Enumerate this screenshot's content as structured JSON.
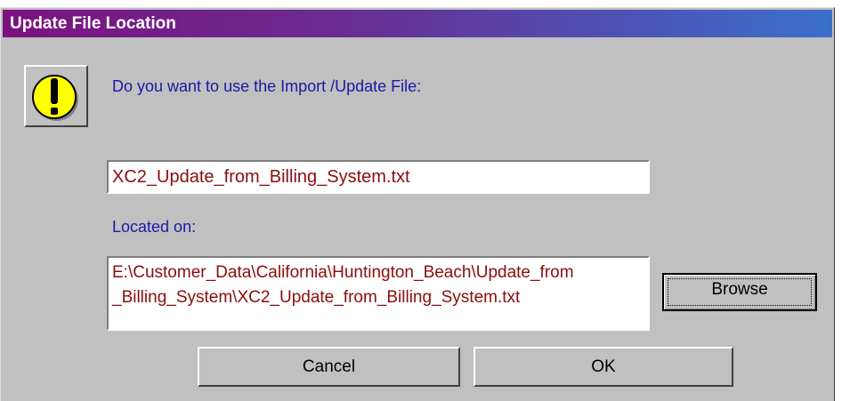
{
  "window": {
    "title": "Update File Location"
  },
  "icon": {
    "name": "warning-exclamation-icon",
    "color": "#ffff00"
  },
  "prompt": {
    "question": "Do you want to use the Import /Update File:",
    "located_label": "Located on:"
  },
  "fields": {
    "filename": "XC2_Update_from_Billing_System.txt",
    "location": "E:\\Customer_Data\\California\\Huntington_Beach\\Update_from\n_Billing_System\\XC2_Update_from_Billing_System.txt"
  },
  "buttons": {
    "browse": "Browse",
    "cancel": "Cancel",
    "ok": "OK"
  },
  "colors": {
    "title_start": "#7b1280",
    "title_end": "#3b6fcc",
    "label_text": "#1a1aa6",
    "field_text": "#8b0d0d"
  }
}
